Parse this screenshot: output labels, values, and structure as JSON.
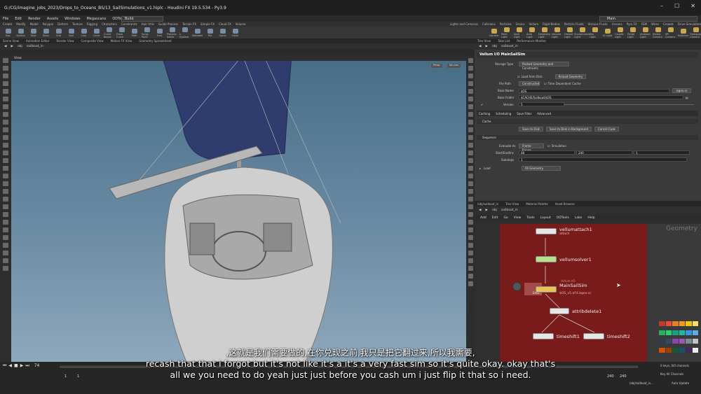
{
  "window": {
    "title": "G:/CG/imagine_jobs_2023/Drops_to_Oceans_BS/13_SailSimulations_v1.hiplc - Houdini FX 19.5.534 - Py3.9",
    "desktop_left": "Build",
    "desktop_right": "Main"
  },
  "menu": [
    "File",
    "Edit",
    "Render",
    "Assets",
    "Windows",
    "Megascans",
    "ODTools",
    "Labs",
    "Help"
  ],
  "shelf_tabs": [
    "Create",
    "Modify",
    "Model",
    "Polygon",
    "Deform",
    "Texture",
    "Rigging",
    "Characters",
    "Constraints",
    "Hair Utils",
    "Guide Process",
    "Terrain FX",
    "Simple FX",
    "Cloud FX",
    "Volume"
  ],
  "shelf_tabs_right": [
    "Lights and Cameras",
    "Collisions",
    "Particles",
    "Grains",
    "Vellum",
    "Rigid Bodies",
    "Particle Fluids",
    "Viscous Fluids",
    "Oceans",
    "Pyro FX",
    "FEM",
    "Wires",
    "Crowds",
    "Drive Simulation"
  ],
  "tools_left": [
    "Box",
    "Sphere",
    "Tube",
    "Torus",
    "Grid",
    "Null",
    "Line",
    "Circle",
    "Curve Bezier",
    "Draw Curve",
    "Path",
    "Spray Paint",
    "Font",
    "Platonic Solids",
    "L-System",
    "Metaball",
    "File",
    "Spiral",
    "Helix"
  ],
  "tools_right": [
    "Camera",
    "Point Light",
    "Spot Light",
    "Area Light",
    "Geometry Light",
    "Volume Light",
    "Distant Light",
    "Environment Light",
    "Sky Light",
    "GI Light",
    "Caustic Light",
    "Portal Light",
    "Ambient Light",
    "Stereo Camera",
    "VR Camera",
    "Switcher",
    "Gamepad Camera"
  ],
  "view_tabs": [
    "Scene View",
    "Animation Editor",
    "Render View",
    "Composite View",
    "Motion FX View",
    "Geometry Spreadsheet"
  ],
  "right_tabs": [
    "Tree View",
    "Take List",
    "Performance Monitor"
  ],
  "viewport": {
    "path_obj": "obj",
    "path_node": "sailboat_in",
    "label": "View",
    "persp": "Persp",
    "cam": "No cam"
  },
  "params": {
    "path_obj": "obj",
    "path_node": "sailboat_in",
    "node_title": "Vellum I/O  MainSailSim",
    "storage_type_label": "Storage Type",
    "storage_type": "Packed Geometry and Constraints",
    "load_from_disk": "Load from Disk",
    "reload_geometry": "Reload Geometry",
    "file_path_label": "File Path",
    "file_path": "Constructed",
    "time_dependent": "Time Dependent Cache",
    "base_name_label": "Base Name",
    "base_name": "$OS",
    "base_ext": ".bgeo.sc",
    "base_folder_label": "Base Folder",
    "base_folder": "$CACHE/Sailboat/$OS",
    "version_label": "Version",
    "version": "5",
    "tabs": [
      "Caching",
      "Scheduling",
      "Save Filter",
      "Advanced"
    ],
    "cache_section": "Cache",
    "save_to_disk": "Save to Disk",
    "save_bg": "Save to Disk in Background",
    "cancel_cook": "Cancel Cook",
    "sequence_section": "Sequence",
    "evaluate_as_label": "Evaluate As",
    "evaluate_as": "Frame Range",
    "simulation": "Simulation",
    "start_end_label": "Start/End/Inc",
    "start": "48",
    "end": "240",
    "inc": "1",
    "substeps_label": "Substeps",
    "substeps": "1",
    "load_label": "Load",
    "load_value": "All Geometry"
  },
  "network": {
    "tabs": [
      "/obj/sailboat_in",
      "Tree View",
      "Material Palette",
      "Asset Browser"
    ],
    "path_obj": "obj",
    "path_node": "sailboat_in",
    "menu": [
      "Add",
      "Edit",
      "Go",
      "View",
      "Tools",
      "Layout",
      "ODTools",
      "Labs",
      "Help"
    ],
    "context": "Geometry",
    "nodes": [
      {
        "name": "vellumattach1",
        "sub": "attach"
      },
      {
        "name": "vellumsolver1",
        "sub": ""
      },
      {
        "name": "MainSailSim",
        "sub": "$OS_v5.$F4.bgeo.sc"
      },
      {
        "name": "attribdelete1",
        "sub": ""
      },
      {
        "name": "timeshift1",
        "sub": ""
      },
      {
        "name": "timeshift2",
        "sub": ""
      }
    ],
    "ghost_label": "Vellum I/O",
    "left_ghost": "Emb..."
  },
  "timeline": {
    "frame": "74",
    "start": "1",
    "start2": "1",
    "end": "240",
    "end2": "240",
    "keys": "0 keys, 0/0 channels",
    "key_all": "Key All Channels",
    "auto_update": "Auto Update",
    "path": "/obj/sailboat_in..."
  },
  "subtitles": {
    "zh": ",这就是我们需要做的,在你兑现之前,我只是把它翻过来,所以我需要,",
    "en1": "recash that that i forgot but it's not like it's a it's a very fast sim so it's quite okay. okay that's",
    "en2": "all we you need to do yeah just just before you cash um i just flip it that so i need."
  },
  "colors": {
    "network_bg": "#7a1b1b",
    "sky_top": "#476d86",
    "sail": "#2e3d6e"
  }
}
